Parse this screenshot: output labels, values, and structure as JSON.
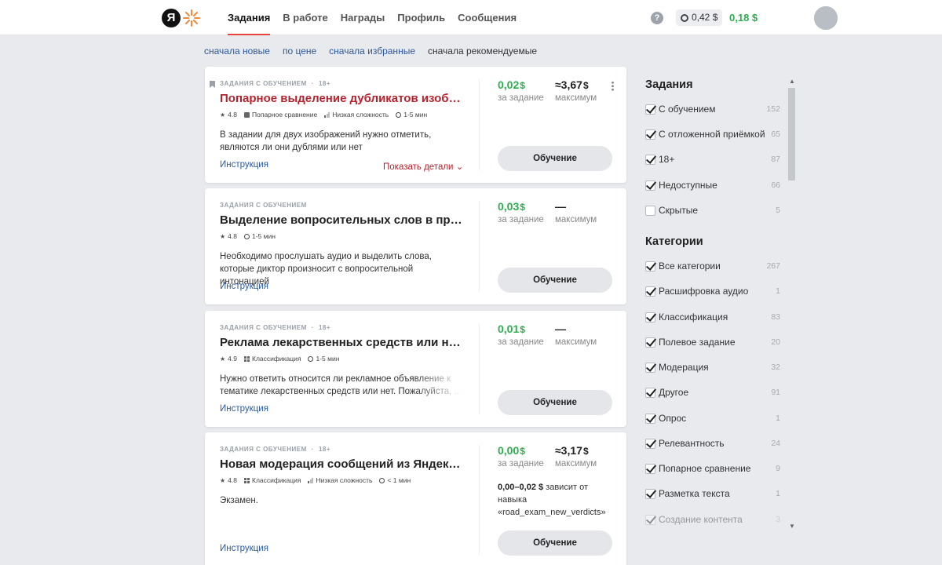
{
  "header": {
    "logo_letter": "Я",
    "nav": [
      {
        "label": "Задания",
        "active": true
      },
      {
        "label": "В работе",
        "active": false
      },
      {
        "label": "Награды",
        "active": false
      },
      {
        "label": "Профиль",
        "active": false
      },
      {
        "label": "Сообщения",
        "active": false
      }
    ],
    "help_label": "?",
    "pending_balance": "0,42 $",
    "balance": "0,18 $"
  },
  "sort_options": [
    "сначала новые",
    "по цене",
    "сначала избранные",
    "сначала рекомендуемые"
  ],
  "tasks": [
    {
      "tag": "Задания с обучением",
      "age": "18+",
      "title": "Попарное выделение дубликатов изображе...",
      "rating": "4.8",
      "category": "Попарное сравнение",
      "difficulty": "Низкая сложность",
      "duration": "1-5 мин",
      "description": "В задании для двух изображений нужно отметить, являются ли они дублями или нет",
      "instruction_label": "Инструкция",
      "details_label": "Показать детали",
      "price": "0,02",
      "price_label": "за задание",
      "max": "≈3,67",
      "max_label": "максимум",
      "currency": "$",
      "button": "Обучение"
    },
    {
      "tag": "Задания с обучением",
      "title": "Выделение вопросительных слов в предло...",
      "rating": "4.8",
      "duration": "1-5 мин",
      "description": "Необходимо прослушать аудио и выделить слова, которые диктор произносит с вопросительной интонацией",
      "instruction_label": "Инструкция",
      "price": "0,03",
      "price_label": "за задание",
      "max": "—",
      "max_label": "максимум",
      "currency": "$",
      "button": "Обучение"
    },
    {
      "tag": "Задания с обучением",
      "age": "18+",
      "title": "Реклама лекарственных средств или нет?",
      "rating": "4.9",
      "category": "Классификация",
      "duration": "1-5 мин",
      "description": "Нужно ответить относится ли рекламное объявление к тематике лекарственных средств или нет. Пожалуйста, ...",
      "instruction_label": "Инструкция",
      "price": "0,01",
      "price_label": "за задание",
      "max": "—",
      "max_label": "максимум",
      "currency": "$",
      "button": "Обучение"
    },
    {
      "tag": "Задания с обучением",
      "age": "18+",
      "title": "Новая модерация сообщений из Яндекс.Нав...",
      "rating": "4.8",
      "category": "Классификация",
      "difficulty": "Низкая сложность",
      "duration": "< 1 мин",
      "description": "Экзамен.",
      "instruction_label": "Инструкция",
      "price": "0,00",
      "price_label": "за задание",
      "max": "≈3,17",
      "max_label": "максимум",
      "currency": "$",
      "depends_range": "0,00–0,02 $",
      "depends_text": " зависит от навыка «road_exam_new_verdicts»",
      "button": "Обучение"
    }
  ],
  "sidebar": {
    "tasks_title": "Задания",
    "task_filters": [
      {
        "label": "С обучением",
        "count": "152",
        "checked": true
      },
      {
        "label": "С отложенной приёмкой",
        "count": "65",
        "checked": true
      },
      {
        "label": "18+",
        "count": "87",
        "checked": true
      },
      {
        "label": "Недоступные",
        "count": "66",
        "checked": true
      },
      {
        "label": "Скрытые",
        "count": "5",
        "checked": false
      }
    ],
    "categories_title": "Категории",
    "category_filters": [
      {
        "label": "Все категории",
        "count": "267",
        "checked": true
      },
      {
        "label": "Расшифровка аудио",
        "count": "1",
        "checked": true
      },
      {
        "label": "Классификация",
        "count": "83",
        "checked": true
      },
      {
        "label": "Полевое задание",
        "count": "20",
        "checked": true
      },
      {
        "label": "Модерация",
        "count": "32",
        "checked": true
      },
      {
        "label": "Другое",
        "count": "91",
        "checked": true
      },
      {
        "label": "Опрос",
        "count": "1",
        "checked": true
      },
      {
        "label": "Релевантность",
        "count": "24",
        "checked": true
      },
      {
        "label": "Попарное сравнение",
        "count": "9",
        "checked": true
      },
      {
        "label": "Разметка текста",
        "count": "1",
        "checked": true
      },
      {
        "label": "Создание контента",
        "count": "3",
        "checked": true
      }
    ]
  },
  "colors": {
    "accent_red": "#e8423f",
    "price_green": "#2dad4f",
    "link_blue": "#2b5a9c",
    "title_red": "#b4232d"
  }
}
